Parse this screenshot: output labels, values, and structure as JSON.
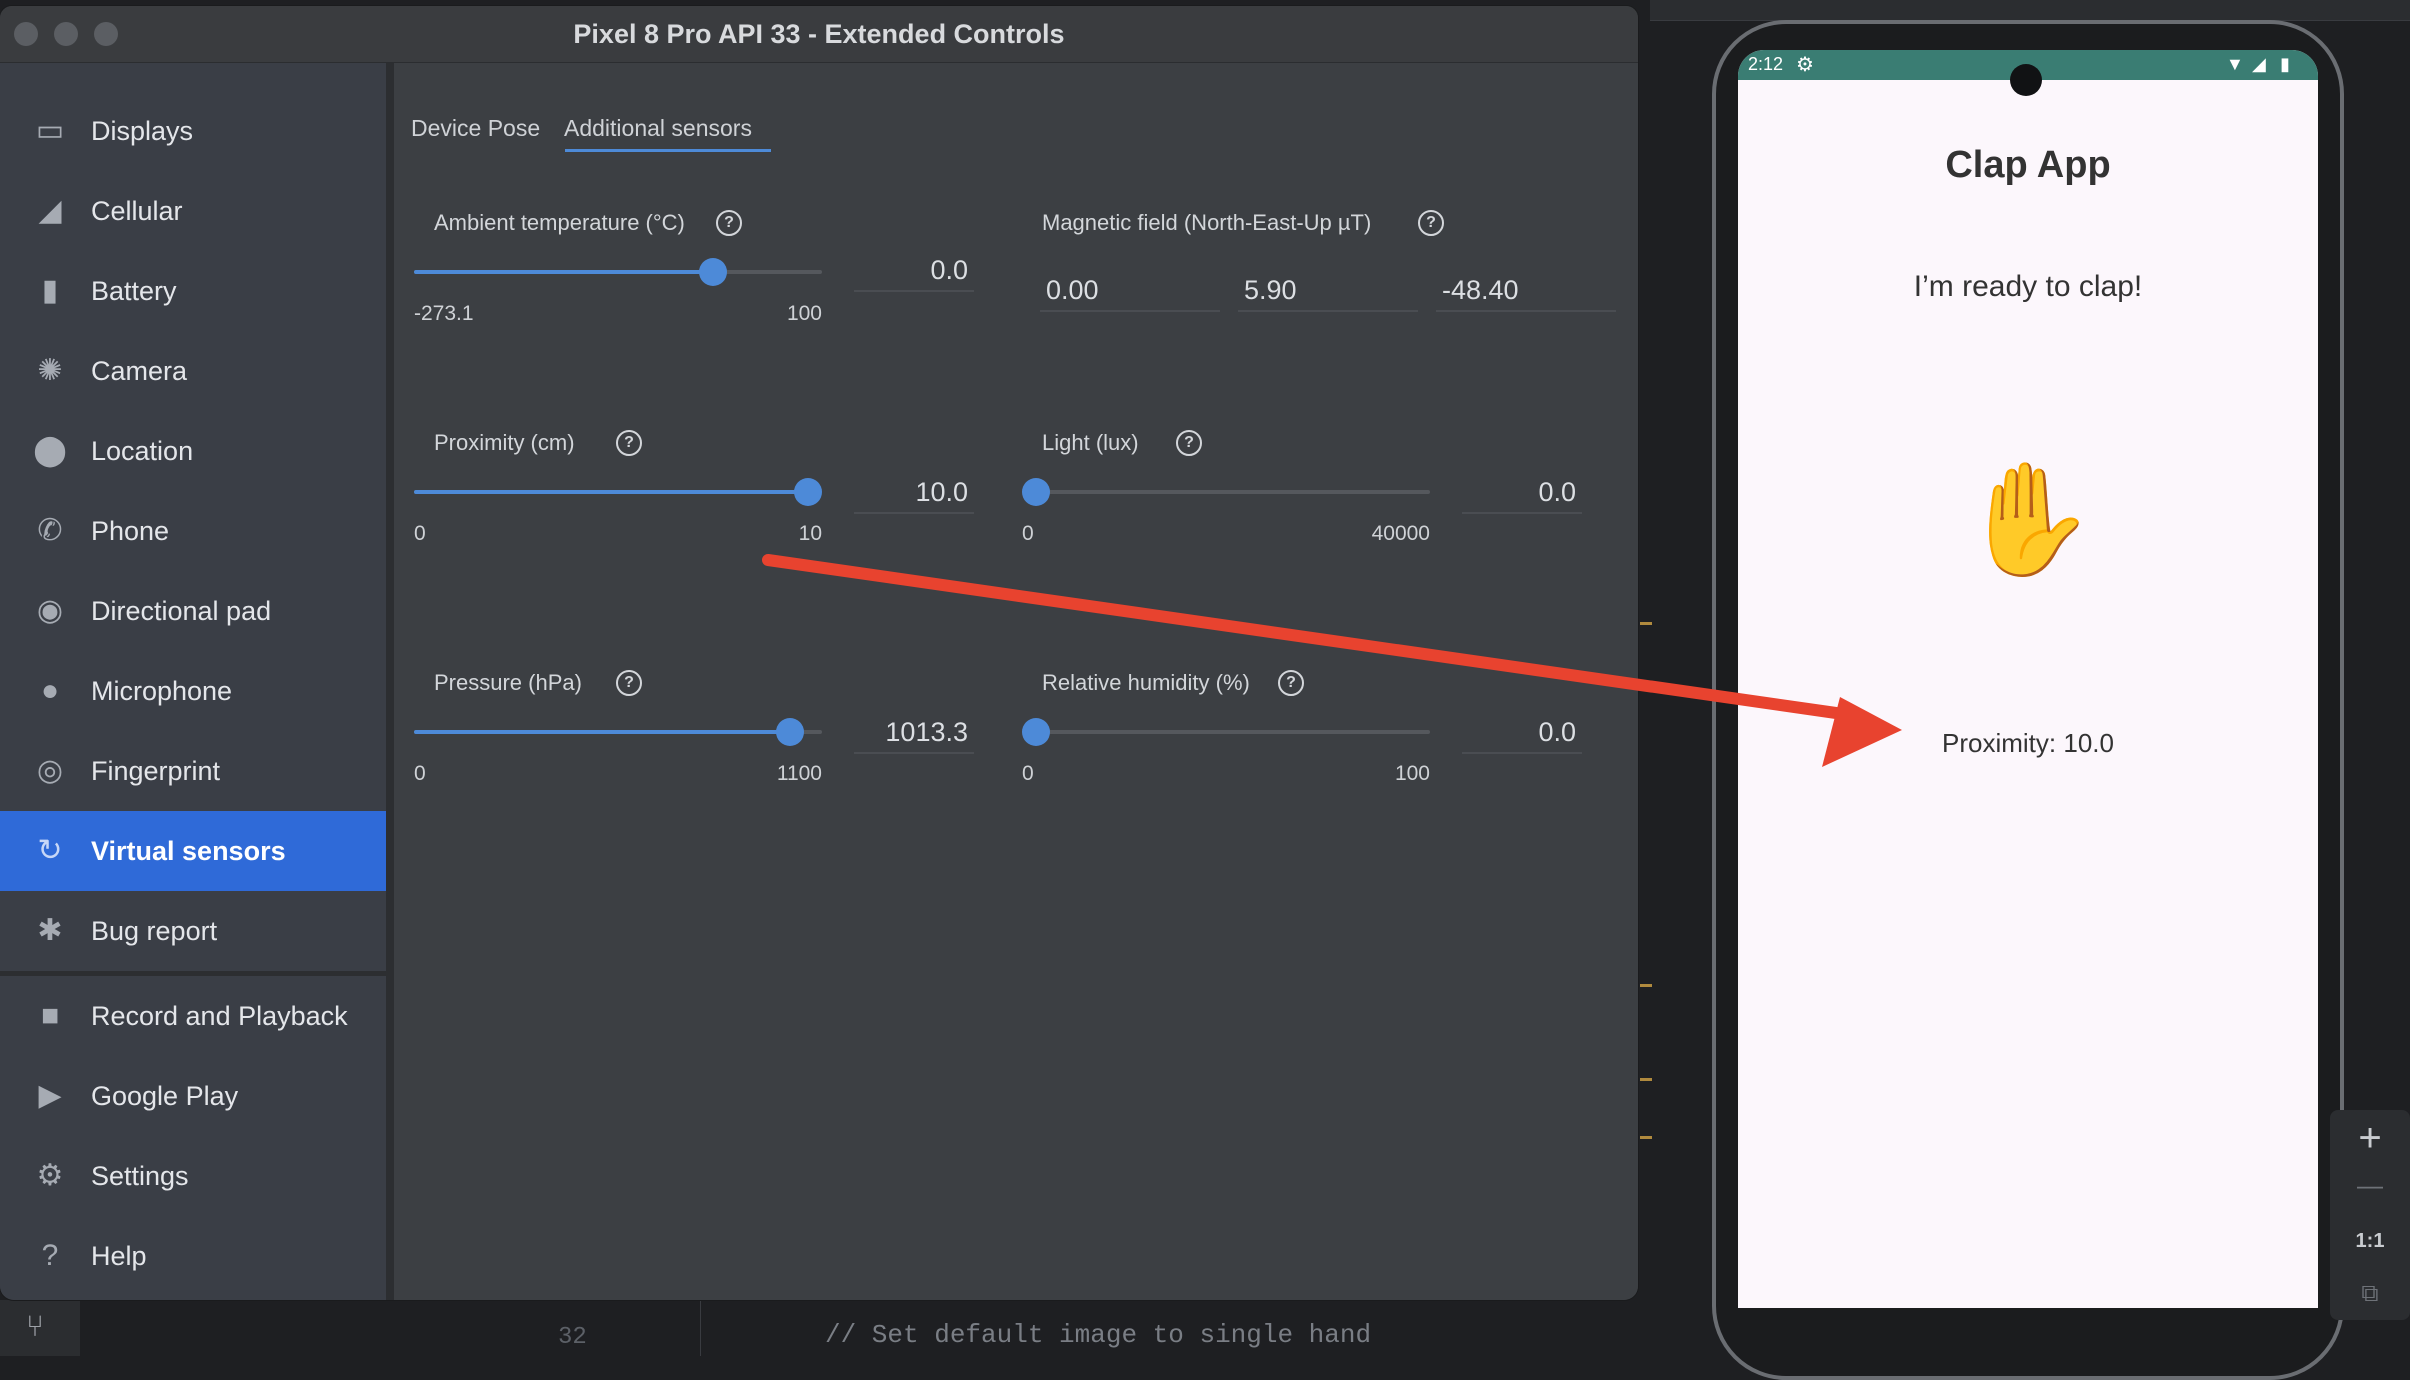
{
  "window": {
    "title": "Pixel 8 Pro API 33 - Extended Controls"
  },
  "sidebar": {
    "items": [
      {
        "label": "Displays",
        "icon": "monitor-icon"
      },
      {
        "label": "Cellular",
        "icon": "cellular-signal-icon"
      },
      {
        "label": "Battery",
        "icon": "battery-icon"
      },
      {
        "label": "Camera",
        "icon": "aperture-icon"
      },
      {
        "label": "Location",
        "icon": "location-pin-icon"
      },
      {
        "label": "Phone",
        "icon": "phone-icon"
      },
      {
        "label": "Directional pad",
        "icon": "dpad-icon"
      },
      {
        "label": "Microphone",
        "icon": "microphone-icon"
      },
      {
        "label": "Fingerprint",
        "icon": "fingerprint-icon"
      },
      {
        "label": "Virtual sensors",
        "icon": "rotate-sensor-icon",
        "active": true
      },
      {
        "label": "Bug report",
        "icon": "bug-icon"
      },
      {
        "label": "Record and Playback",
        "icon": "video-camera-icon"
      },
      {
        "label": "Google Play",
        "icon": "play-store-icon"
      },
      {
        "label": "Settings",
        "icon": "gear-icon"
      },
      {
        "label": "Help",
        "icon": "help-icon"
      }
    ]
  },
  "tabs": {
    "device_pose": "Device Pose",
    "additional_sensors": "Additional sensors",
    "active": "Additional sensors"
  },
  "sensors": {
    "ambient_temperature": {
      "label": "Ambient temperature (°C)",
      "min": "-273.1",
      "max": "100",
      "value": "0.0",
      "level": 0.732
    },
    "magnetic_field": {
      "label": "Magnetic field (North-East-Up µT)",
      "x": "0.00",
      "y": "5.90",
      "z": "-48.40"
    },
    "proximity": {
      "label": "Proximity (cm)",
      "min": "0",
      "max": "10",
      "value": "10.0",
      "level": 1.0
    },
    "light": {
      "label": "Light (lux)",
      "min": "0",
      "max": "40000",
      "value": "0.0",
      "level": 0.0
    },
    "pressure": {
      "label": "Pressure (hPa)",
      "min": "0",
      "max": "1100",
      "value": "1013.3",
      "level": 0.921
    },
    "relative_humidity": {
      "label": "Relative humidity (%)",
      "min": "0",
      "max": "100",
      "value": "0.0",
      "level": 0.0
    }
  },
  "phone": {
    "time": "2:12",
    "app_title": "Clap App",
    "status_message": "I’m ready to clap!",
    "hand_emoji": "✋",
    "proximity_readout": "Proximity: 10.0"
  },
  "phone_toolbar": {
    "zoom_in": "+",
    "zoom_out": "—",
    "actual_size": "1:1"
  },
  "editor": {
    "line_number": "32",
    "code_line": "// Set default image to single hand"
  },
  "colors": {
    "accent": "#4d8ad8",
    "sidebar_active": "#2f6ad8",
    "arrow": "#e8432f",
    "status_bar": "#3a7d73"
  }
}
